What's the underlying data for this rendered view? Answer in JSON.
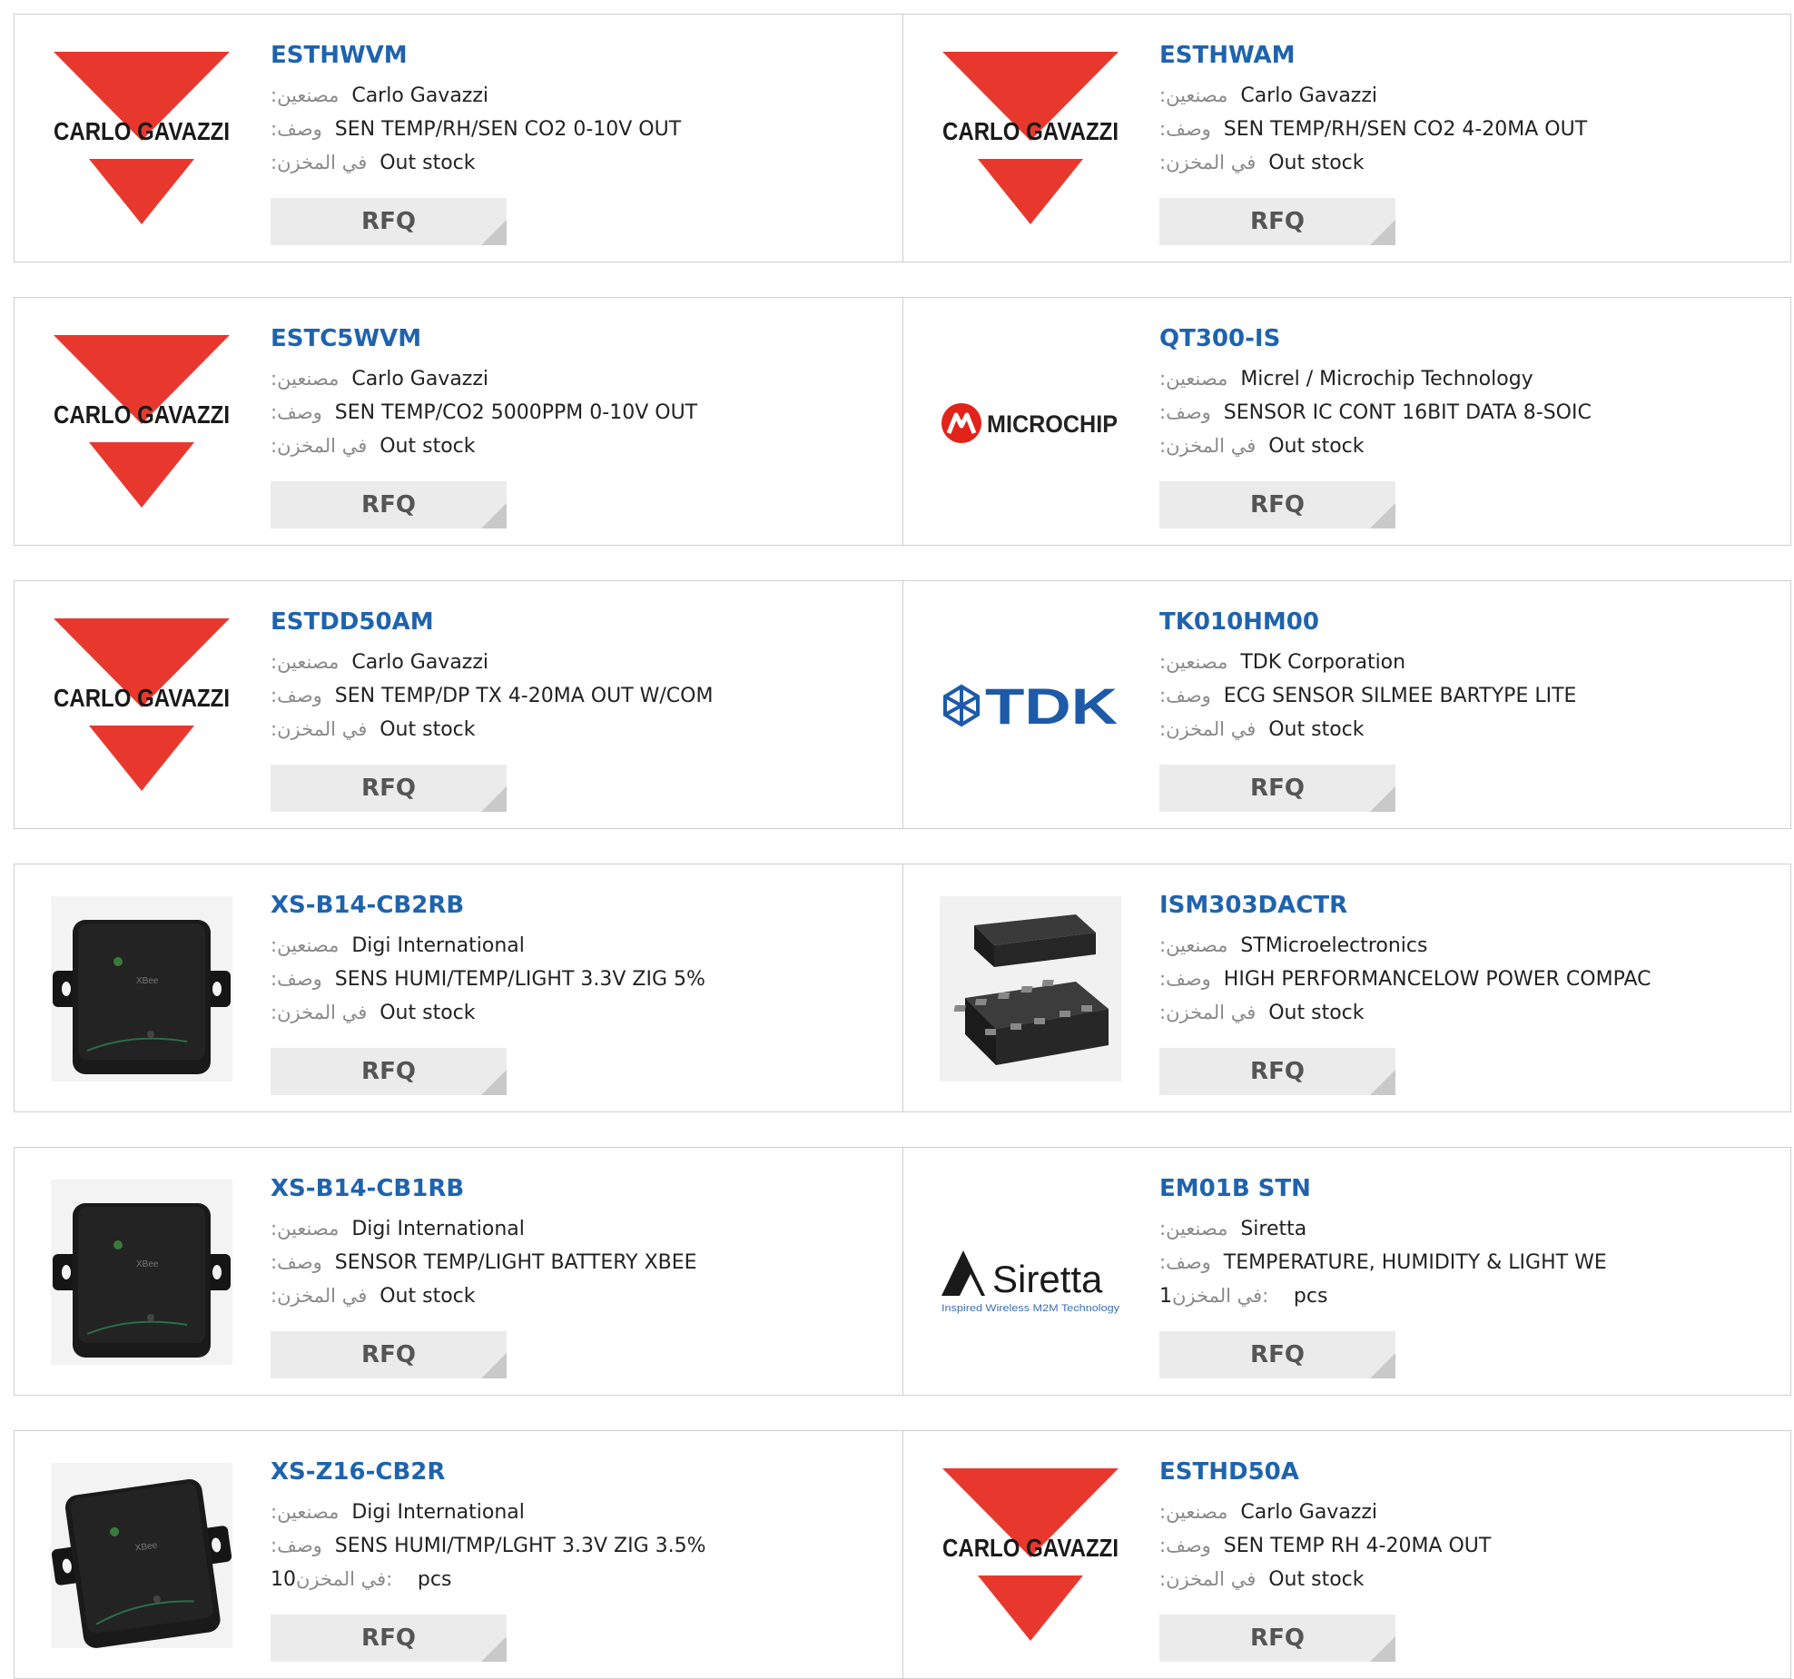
{
  "labels": {
    "manufacturer": ":مصنعين",
    "description": ":وصف",
    "stock": ":في المخزن",
    "stock_qty_prefix": "في المخزن: "
  },
  "rows": [
    [
      {
        "part": "ESTHWVM",
        "manufacturer": "Carlo Gavazzi",
        "description": "SEN TEMP/RH/SEN CO2 0-10V OUT",
        "stock": "Out stock",
        "qty": null,
        "rfq": "RFQ",
        "logo": "carlo-gavazzi"
      },
      {
        "part": "ESTHWAM",
        "manufacturer": "Carlo Gavazzi",
        "description": "SEN TEMP/RH/SEN CO2 4-20MA OUT",
        "stock": "Out stock",
        "qty": null,
        "rfq": "RFQ",
        "logo": "carlo-gavazzi"
      }
    ],
    [
      {
        "part": "ESTC5WVM",
        "manufacturer": "Carlo Gavazzi",
        "description": "SEN TEMP/CO2 5000PPM 0-10V OUT",
        "stock": "Out stock",
        "qty": null,
        "rfq": "RFQ",
        "logo": "carlo-gavazzi"
      },
      {
        "part": "QT300-IS",
        "manufacturer": "Micrel / Microchip Technology",
        "description": "SENSOR IC CONT 16BIT DATA 8-SOIC",
        "stock": "Out stock",
        "qty": null,
        "rfq": "RFQ",
        "logo": "microchip"
      }
    ],
    [
      {
        "part": "ESTDD50AM",
        "manufacturer": "Carlo Gavazzi",
        "description": "SEN TEMP/DP TX 4-20MA OUT W/COM",
        "stock": "Out stock",
        "qty": null,
        "rfq": "RFQ",
        "logo": "carlo-gavazzi"
      },
      {
        "part": "TK010HM00",
        "manufacturer": "TDK Corporation",
        "description": "ECG SENSOR SILMEE BARTYPE LITE",
        "stock": "Out stock",
        "qty": null,
        "rfq": "RFQ",
        "logo": "tdk"
      }
    ],
    [
      {
        "part": "XS-B14-CB2RB",
        "manufacturer": "Digi International",
        "description": "SENS HUMI/TEMP/LIGHT 3.3V ZIG 5%",
        "stock": "Out stock",
        "qty": null,
        "rfq": "RFQ",
        "logo": "xbee-box"
      },
      {
        "part": "ISM303DACTR",
        "manufacturer": "STMicroelectronics",
        "description": "HIGH PERFORMANCELOW POWER COMPAC",
        "stock": "Out stock",
        "qty": null,
        "rfq": "RFQ",
        "logo": "lga-chip"
      }
    ],
    [
      {
        "part": "XS-B14-CB1RB",
        "manufacturer": "Digi International",
        "description": "SENSOR TEMP/LIGHT BATTERY XBEE",
        "stock": "Out stock",
        "qty": null,
        "rfq": "RFQ",
        "logo": "xbee-box"
      },
      {
        "part": "EM01B STN",
        "manufacturer": "Siretta",
        "description": "TEMPERATURE, HUMIDITY & LIGHT WE",
        "stock": null,
        "qty": "1",
        "qty_unit": "pcs",
        "rfq": "RFQ",
        "logo": "siretta"
      }
    ],
    [
      {
        "part": "XS-Z16-CB2R",
        "manufacturer": "Digi International",
        "description": "SENS HUMI/TMP/LGHT 3.3V ZIG 3.5%",
        "stock": null,
        "qty": "10",
        "qty_unit": "pcs",
        "rfq": "RFQ",
        "logo": "xbee-box-angled"
      },
      {
        "part": "ESTHD50A",
        "manufacturer": "Carlo Gavazzi",
        "description": "SEN TEMP RH 4-20MA OUT",
        "stock": "Out stock",
        "qty": null,
        "rfq": "RFQ",
        "logo": "carlo-gavazzi"
      }
    ]
  ],
  "logo_text": {
    "carlo-gavazzi": "CARLO GAVAZZI",
    "microchip": "MICROCHIP",
    "tdk": "TDK",
    "siretta": "Siretta",
    "siretta_tag": "Inspired Wireless M2M Technology",
    "xbee": "XBee"
  },
  "colors": {
    "link": "#1f63ad",
    "gavazzi_red": "#e8382e",
    "microchip_red": "#e2231a",
    "tdk_blue": "#1d5aa8",
    "border": "#cfcfcf",
    "rfq_bg": "#ebebeb"
  }
}
